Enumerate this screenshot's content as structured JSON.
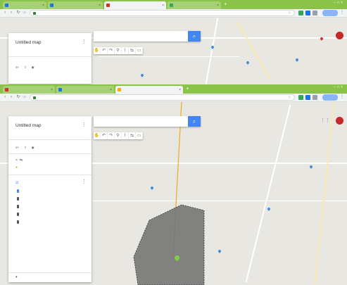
{
  "top_window": {
    "tabs": [
      {
        "label": "",
        "color": "#1a73e8",
        "active": false
      },
      {
        "label": "",
        "color": "#1a73e8",
        "active": false
      },
      {
        "label": "",
        "color": "#d93025",
        "active": true
      },
      {
        "label": "",
        "color": "#34a853",
        "active": false
      }
    ],
    "url": "",
    "profile_label": "",
    "panel": {
      "title": "Untitled map",
      "subtitle": ""
    },
    "search_placeholder": ""
  },
  "bottom_window": {
    "tabs": [
      {
        "label": "",
        "color": "#d93025",
        "active": false
      },
      {
        "label": "",
        "color": "#1a73e8",
        "active": false
      },
      {
        "label": "",
        "color": "#f9ab00",
        "active": true
      }
    ],
    "url": "",
    "profile_label": "",
    "panel": {
      "title": "Untitled map",
      "subtitle": "",
      "layer_title": "",
      "layer_items": [
        "",
        "",
        "",
        "",
        ""
      ],
      "base_map": ""
    },
    "search_placeholder": ""
  },
  "colors": {
    "tabstrip": "#8bc34a",
    "search_button": "#4285f4",
    "polygon_fill": "#6f6f6f",
    "marker": "#7cd13d",
    "route": "#f6a623"
  },
  "icons": {
    "search": "search-icon",
    "menu": "kebab-icon",
    "avatar": "avatar-icon"
  }
}
